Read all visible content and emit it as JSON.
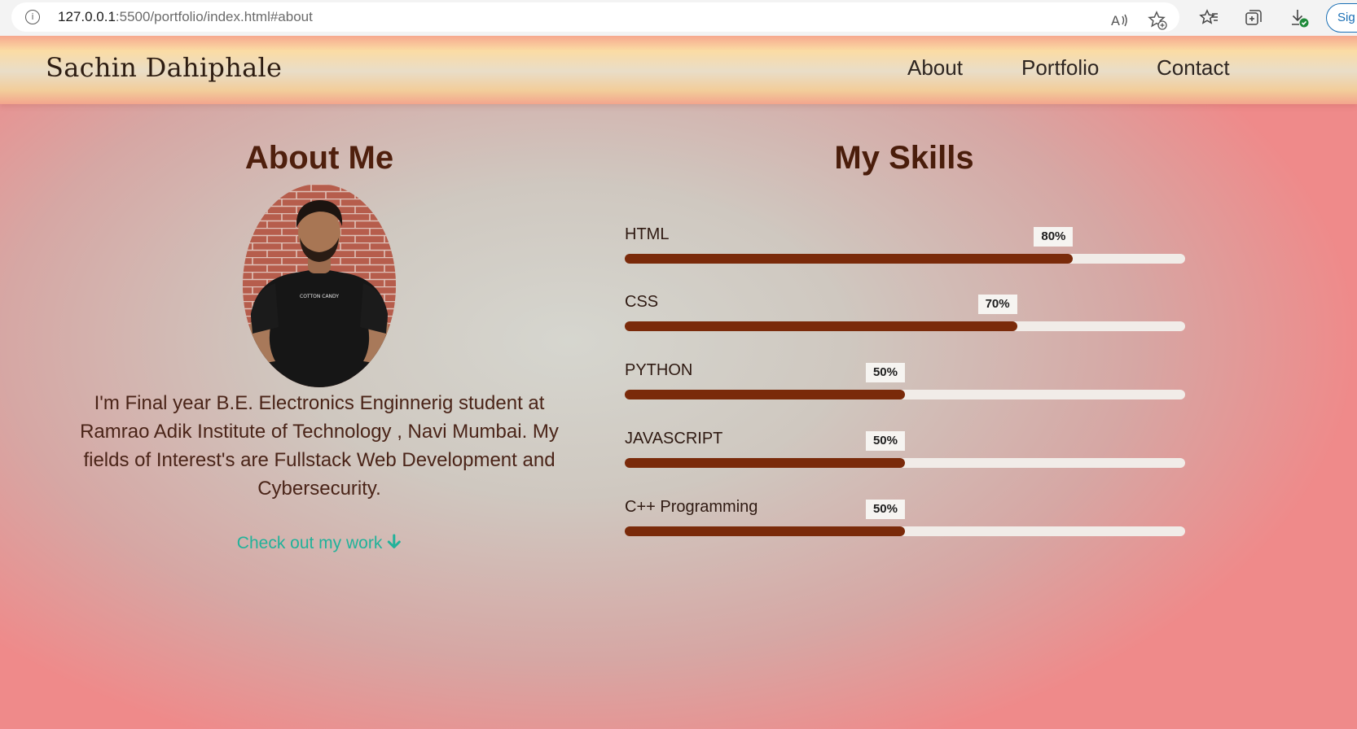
{
  "browser": {
    "url_host": "127.0.0.1",
    "url_path": ":5500/portfolio/index.html#about",
    "signin_label": "Sig"
  },
  "header": {
    "brand": "Sachin Dahiphale",
    "nav": [
      {
        "label": "About"
      },
      {
        "label": "Portfolio"
      },
      {
        "label": "Contact"
      }
    ]
  },
  "about": {
    "title": "About Me",
    "description": "I'm Final year B.E. Electronics Enginnerig student at Ramrao Adik Institute of Technology , Navi Mumbai. My fields of Interest's are Fullstack Web Development and Cybersecurity.",
    "cta_label": "Check out my work",
    "cta_icon": "arrow-down-icon"
  },
  "skills": {
    "title": "My Skills",
    "items": [
      {
        "name": "HTML",
        "percent": 80,
        "label": "80%"
      },
      {
        "name": "CSS",
        "percent": 70,
        "label": "70%"
      },
      {
        "name": "PYTHON",
        "percent": 50,
        "label": "50%"
      },
      {
        "name": "JAVASCRIPT",
        "percent": 50,
        "label": "50%"
      },
      {
        "name": "C++ Programming",
        "percent": 50,
        "label": "50%"
      }
    ]
  },
  "colors": {
    "skill_fill": "#7a2a0a",
    "skill_track": "#f1ece8",
    "cta": "#21b29a",
    "heading": "#4f1f0d"
  }
}
